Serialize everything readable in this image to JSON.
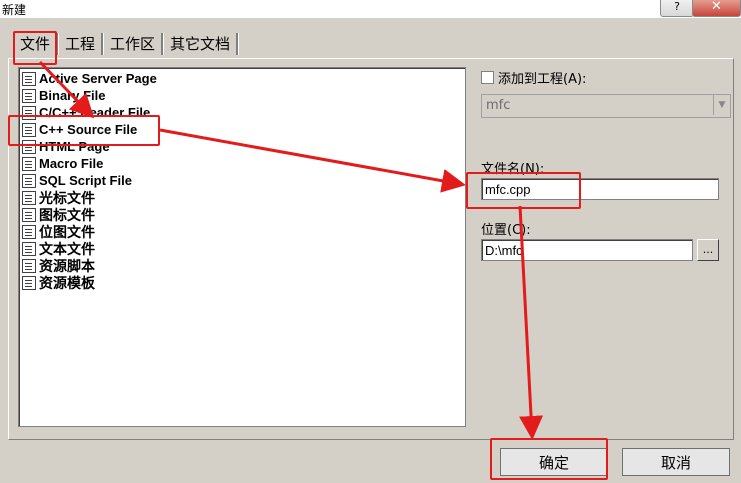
{
  "window": {
    "title": "新建",
    "help_glyph": "?",
    "close_glyph": "✕"
  },
  "tabs": [
    "文件",
    "工程",
    "工作区",
    "其它文档"
  ],
  "file_types": [
    "Active Server Page",
    "Binary File",
    "C/C++ Header File",
    "C++ Source File",
    "HTML Page",
    "Macro File",
    "SQL Script File",
    "光标文件",
    "图标文件",
    "位图文件",
    "文本文件",
    "资源脚本",
    "资源模板"
  ],
  "add_to_project": {
    "label": "添加到工程(A):",
    "checked": false,
    "combo_value": "mfc"
  },
  "filename": {
    "label": "文件名(N):",
    "value": "mfc.cpp"
  },
  "location": {
    "label": "位置(C):",
    "value": "D:\\mfc",
    "browse_label": "..."
  },
  "buttons": {
    "ok": "确定",
    "cancel": "取消"
  },
  "colors": {
    "annotation": "#e31b1b",
    "dialog_bg": "#d4d0c8"
  }
}
